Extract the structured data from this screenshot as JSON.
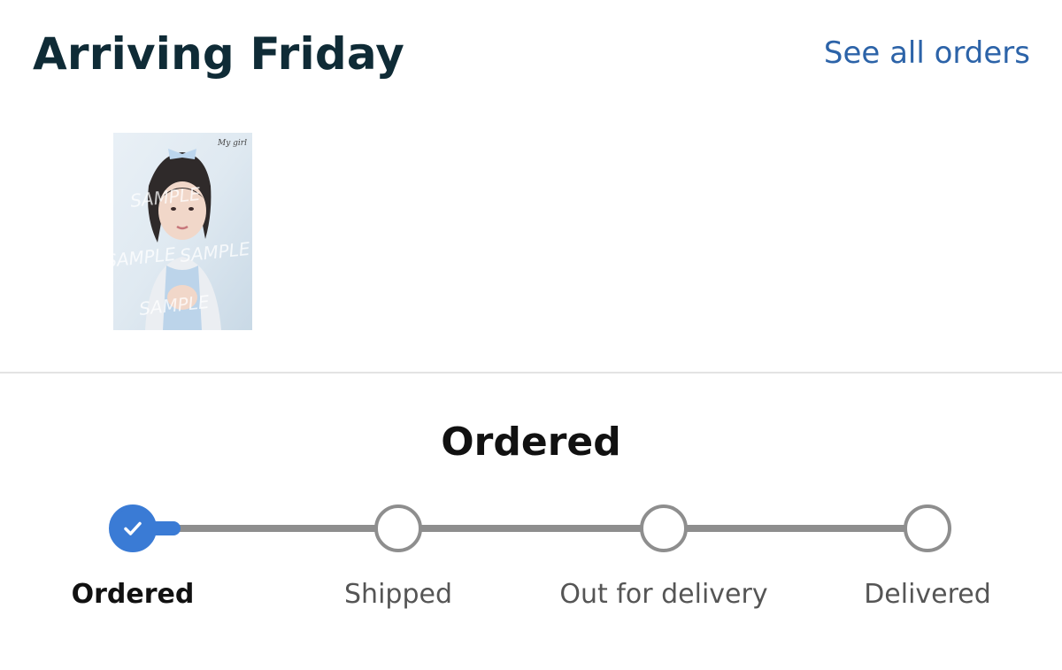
{
  "header": {
    "title": "Arriving Friday",
    "see_all_orders": "See all orders"
  },
  "product": {
    "image_alt": "Product photo",
    "watermark": "SAMPLE",
    "cover_text": "My girl"
  },
  "status": {
    "heading": "Ordered",
    "progress_fraction": 0.06
  },
  "steps": [
    {
      "label": "Ordered",
      "complete": true
    },
    {
      "label": "Shipped",
      "complete": false
    },
    {
      "label": "Out for delivery",
      "complete": false
    },
    {
      "label": "Delivered",
      "complete": false
    }
  ],
  "colors": {
    "accent": "#3a7bd5",
    "link": "#2c63a8",
    "title": "#0f2b36",
    "inactive": "#8e8e8e"
  }
}
